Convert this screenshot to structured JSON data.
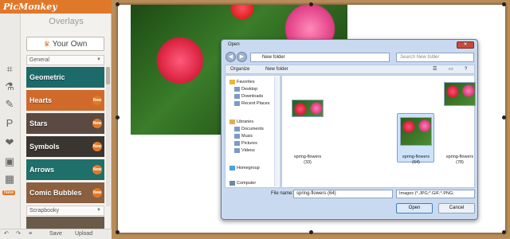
{
  "app": {
    "logo": "PicMonkey",
    "panel_title": "Overlays",
    "your_own_label": "Your Own",
    "category_general": "General",
    "category_scrapbooky": "Scrapbooky",
    "rail_new_tag": "New",
    "tiles": [
      {
        "label": "Geometric",
        "badge": "",
        "color": "#1d6a6a"
      },
      {
        "label": "Hearts",
        "badge": "New",
        "color": "#d06a2a"
      },
      {
        "label": "Stars",
        "badge": "New",
        "color": "#5a4a42"
      },
      {
        "label": "Symbols",
        "badge": "New",
        "color": "#3a3530"
      },
      {
        "label": "Arrows",
        "badge": "New",
        "color": "#1f6f6a"
      },
      {
        "label": "Comic Bubbles",
        "badge": "New",
        "color": "#8a6040"
      }
    ],
    "bottom": {
      "save": "Save",
      "upload": "Upload"
    }
  },
  "dialog": {
    "title": "Open",
    "address": "New folder",
    "search_placeholder": "Search New folder",
    "organize": "Organize",
    "new_folder": "New folder",
    "nav": [
      "Favorites",
      "Desktop",
      "Downloads",
      "Recent Places",
      "Libraries",
      "Documents",
      "Music",
      "Pictures",
      "Videos",
      "Homegroup",
      "Computer"
    ],
    "files": [
      {
        "name": "spring-flowers",
        "num": "(33)"
      },
      {
        "name": "spring-flowers",
        "num": "(64)"
      },
      {
        "name": "spring-flowers",
        "num": "(78)"
      }
    ],
    "filename_label": "File name:",
    "filename_value": "spring-flowers (64)",
    "filetype": "Images (*.JPG;*.GIF;*.PNG;",
    "open": "Open",
    "cancel": "Cancel"
  }
}
